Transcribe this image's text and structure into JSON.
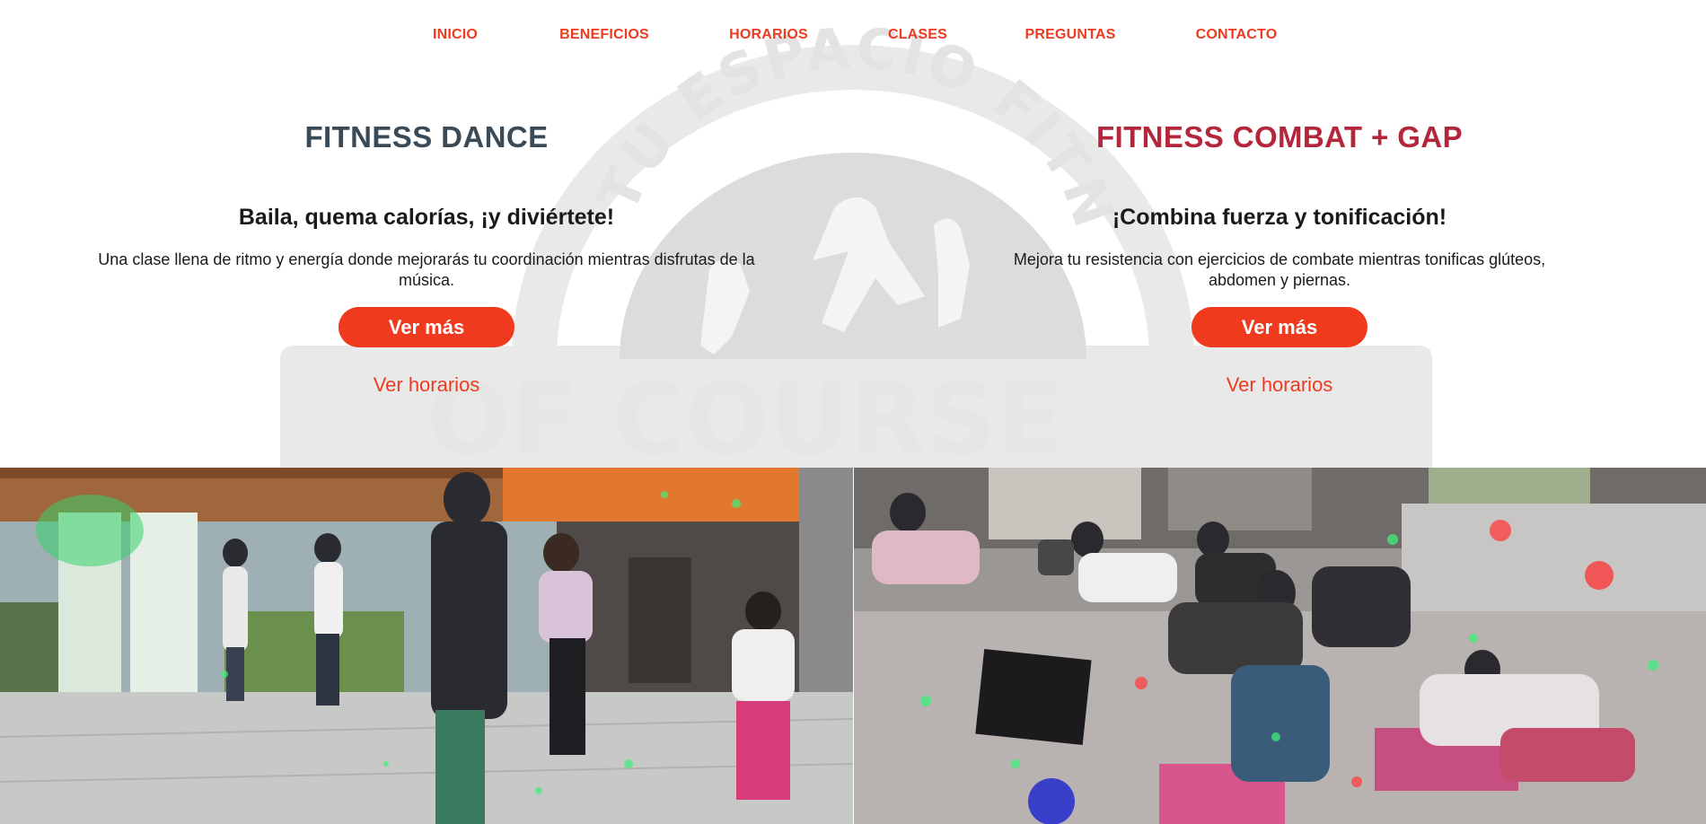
{
  "nav": {
    "items": [
      {
        "label": "INICIO"
      },
      {
        "label": "BENEFICIOS"
      },
      {
        "label": "HORARIOS"
      },
      {
        "label": "CLASES"
      },
      {
        "label": "PREGUNTAS"
      },
      {
        "label": "CONTACTO"
      }
    ]
  },
  "watermark": {
    "arc_text": "TU ESPACIO FITNESS",
    "bottom_text": "OF COURSE"
  },
  "classes": [
    {
      "title": "FITNESS DANCE",
      "subtitle": "Baila, quema calorías, ¡y diviértete!",
      "description": "Una clase llena de ritmo y energía donde mejorarás tu coordinación mientras disfrutas de la música.",
      "more_label": "Ver más",
      "schedule_label": "Ver horarios"
    },
    {
      "title": "FITNESS COMBAT + GAP",
      "subtitle": "¡Combina fuerza y tonificación!",
      "description": "Mejora tu resistencia con ejercicios de combate mientras tonificas glúteos, abdomen y piernas.",
      "more_label": "Ver más",
      "schedule_label": "Ver horarios"
    }
  ],
  "colors": {
    "accent": "#ef3a1d",
    "dance_title": "#3b4a57",
    "combat_title": "#b3263b"
  }
}
